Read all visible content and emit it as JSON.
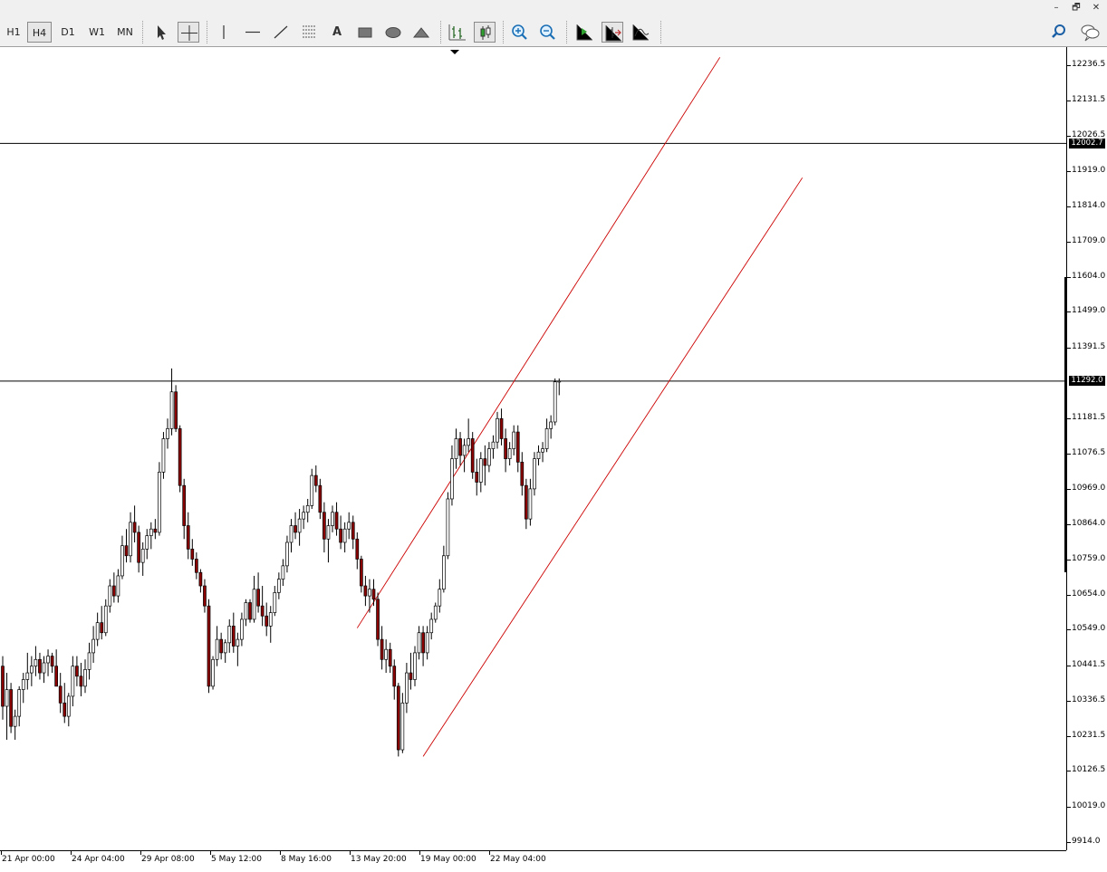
{
  "window": {
    "minimize": "–",
    "restore": "🗗",
    "close": "✕"
  },
  "toolbar": {
    "timeframes": [
      "H1",
      "H4",
      "D1",
      "W1",
      "MN"
    ],
    "active_timeframe": "H4",
    "tools": [
      "cursor-icon",
      "crosshair-icon",
      "vertical-line-icon",
      "horizontal-line-icon",
      "trendline-icon",
      "fibonacci-icon",
      "text-icon",
      "rectangle-icon",
      "ellipse-icon",
      "triangle-icon",
      "bar-chart-icon",
      "candlestick-icon",
      "zoom-in-icon",
      "zoom-out-icon",
      "chart-shift-icon",
      "autoscroll-icon",
      "indicators-icon",
      "search-icon",
      "chat-icon"
    ],
    "text_tool_label": "A"
  },
  "price_scale": {
    "labels": [
      "12236.5",
      "12131.5",
      "12026.5",
      "11919.0",
      "11814.0",
      "11709.0",
      "11604.0",
      "11499.0",
      "11391.5",
      "11181.5",
      "11076.5",
      "10969.0",
      "10864.0",
      "10759.0",
      "10654.0",
      "10549.0",
      "10441.5",
      "10336.5",
      "10231.5",
      "10126.5",
      "10019.0",
      "9914.0"
    ],
    "hline_upper": "12002.7",
    "hline_current": "11292.0"
  },
  "time_scale": {
    "labels": [
      "21 Apr 00:00",
      "24 Apr 04:00",
      "29 Apr 08:00",
      "5 May 12:00",
      "8 May 16:00",
      "13 May 20:00",
      "19 May 00:00",
      "22 May 04:00"
    ]
  },
  "colors": {
    "bull": "#ffffff",
    "bear": "#8b0000",
    "channel": "#cc0000",
    "hline": "#000000"
  },
  "chart_data": {
    "type": "candlestick",
    "symbol_timeframe": "H4",
    "ylim": [
      9914.0,
      12236.5
    ],
    "horizontal_lines": [
      12002.7,
      11292.0
    ],
    "channel": {
      "upper": [
        {
          "bar": 86,
          "price": 10554
        },
        {
          "bar": 174,
          "price": 12260
        }
      ],
      "lower": [
        {
          "bar": 102,
          "price": 10170
        },
        {
          "bar": 194,
          "price": 11900
        }
      ]
    },
    "candles": [
      [
        10440,
        10470,
        10280,
        10320
      ],
      [
        10320,
        10420,
        10220,
        10370
      ],
      [
        10370,
        10390,
        10240,
        10260
      ],
      [
        10260,
        10310,
        10220,
        10290
      ],
      [
        10290,
        10380,
        10260,
        10370
      ],
      [
        10370,
        10420,
        10330,
        10400
      ],
      [
        10400,
        10480,
        10370,
        10420
      ],
      [
        10420,
        10470,
        10380,
        10440
      ],
      [
        10440,
        10500,
        10410,
        10460
      ],
      [
        10460,
        10480,
        10400,
        10420
      ],
      [
        10420,
        10470,
        10390,
        10450
      ],
      [
        10450,
        10490,
        10410,
        10470
      ],
      [
        10470,
        10480,
        10420,
        10440
      ],
      [
        10440,
        10490,
        10400,
        10380
      ],
      [
        10380,
        10420,
        10300,
        10330
      ],
      [
        10330,
        10390,
        10270,
        10290
      ],
      [
        10290,
        10360,
        10260,
        10350
      ],
      [
        10350,
        10470,
        10320,
        10440
      ],
      [
        10440,
        10470,
        10380,
        10410
      ],
      [
        10410,
        10450,
        10350,
        10380
      ],
      [
        10380,
        10460,
        10360,
        10430
      ],
      [
        10430,
        10510,
        10400,
        10480
      ],
      [
        10480,
        10560,
        10450,
        10520
      ],
      [
        10520,
        10600,
        10500,
        10570
      ],
      [
        10570,
        10620,
        10520,
        10540
      ],
      [
        10540,
        10640,
        10530,
        10620
      ],
      [
        10620,
        10700,
        10600,
        10680
      ],
      [
        10680,
        10720,
        10630,
        10650
      ],
      [
        10650,
        10730,
        10630,
        10710
      ],
      [
        10710,
        10830,
        10700,
        10800
      ],
      [
        10800,
        10850,
        10750,
        10770
      ],
      [
        10770,
        10900,
        10750,
        10870
      ],
      [
        10870,
        10920,
        10810,
        10840
      ],
      [
        10840,
        10860,
        10720,
        10750
      ],
      [
        10750,
        10810,
        10710,
        10790
      ],
      [
        10790,
        10850,
        10760,
        10830
      ],
      [
        10830,
        10870,
        10790,
        10850
      ],
      [
        10850,
        10880,
        10820,
        10840
      ],
      [
        10840,
        11050,
        10830,
        11020
      ],
      [
        11020,
        11140,
        11000,
        11120
      ],
      [
        11120,
        11180,
        11090,
        11150
      ],
      [
        11150,
        11330,
        11130,
        11260
      ],
      [
        11260,
        11280,
        11140,
        11150
      ],
      [
        11150,
        11160,
        10960,
        10980
      ],
      [
        10980,
        11000,
        10820,
        10860
      ],
      [
        10860,
        10900,
        10760,
        10790
      ],
      [
        10790,
        10820,
        10740,
        10760
      ],
      [
        10760,
        10780,
        10700,
        10720
      ],
      [
        10720,
        10730,
        10660,
        10680
      ],
      [
        10680,
        10700,
        10600,
        10620
      ],
      [
        10620,
        10640,
        10360,
        10380
      ],
      [
        10380,
        10470,
        10370,
        10460
      ],
      [
        10460,
        10560,
        10440,
        10520
      ],
      [
        10520,
        10540,
        10460,
        10480
      ],
      [
        10480,
        10520,
        10450,
        10510
      ],
      [
        10510,
        10580,
        10480,
        10560
      ],
      [
        10560,
        10600,
        10480,
        10500
      ],
      [
        10500,
        10540,
        10440,
        10520
      ],
      [
        10520,
        10600,
        10500,
        10580
      ],
      [
        10580,
        10640,
        10560,
        10630
      ],
      [
        10630,
        10640,
        10570,
        10580
      ],
      [
        10580,
        10710,
        10570,
        10670
      ],
      [
        10670,
        10720,
        10600,
        10620
      ],
      [
        10620,
        10680,
        10560,
        10590
      ],
      [
        10590,
        10630,
        10530,
        10560
      ],
      [
        10560,
        10620,
        10510,
        10600
      ],
      [
        10600,
        10680,
        10590,
        10660
      ],
      [
        10660,
        10720,
        10640,
        10700
      ],
      [
        10700,
        10760,
        10680,
        10740
      ],
      [
        10740,
        10830,
        10720,
        10810
      ],
      [
        10810,
        10880,
        10780,
        10860
      ],
      [
        10860,
        10900,
        10820,
        10840
      ],
      [
        10840,
        10910,
        10800,
        10880
      ],
      [
        10880,
        10920,
        10850,
        10900
      ],
      [
        10900,
        10940,
        10870,
        10920
      ],
      [
        10920,
        11030,
        10910,
        11010
      ],
      [
        11010,
        11040,
        10960,
        10980
      ],
      [
        10980,
        11000,
        10880,
        10900
      ],
      [
        10900,
        10930,
        10780,
        10820
      ],
      [
        10820,
        10880,
        10750,
        10860
      ],
      [
        10860,
        10920,
        10840,
        10900
      ],
      [
        10900,
        10930,
        10830,
        10850
      ],
      [
        10850,
        10890,
        10790,
        10810
      ],
      [
        10810,
        10870,
        10780,
        10850
      ],
      [
        10850,
        10900,
        10820,
        10870
      ],
      [
        10870,
        10890,
        10790,
        10820
      ],
      [
        10820,
        10840,
        10730,
        10760
      ],
      [
        10760,
        10770,
        10660,
        10680
      ],
      [
        10680,
        10710,
        10620,
        10650
      ],
      [
        10650,
        10700,
        10600,
        10670
      ],
      [
        10670,
        10700,
        10620,
        10640
      ],
      [
        10640,
        10660,
        10500,
        10520
      ],
      [
        10520,
        10560,
        10430,
        10460
      ],
      [
        10460,
        10520,
        10420,
        10490
      ],
      [
        10490,
        10510,
        10420,
        10440
      ],
      [
        10440,
        10460,
        10340,
        10380
      ],
      [
        10380,
        10390,
        10170,
        10190
      ],
      [
        10190,
        10360,
        10180,
        10330
      ],
      [
        10330,
        10450,
        10300,
        10420
      ],
      [
        10420,
        10480,
        10370,
        10400
      ],
      [
        10400,
        10500,
        10380,
        10480
      ],
      [
        10480,
        10560,
        10460,
        10540
      ],
      [
        10540,
        10560,
        10440,
        10480
      ],
      [
        10480,
        10560,
        10460,
        10540
      ],
      [
        10540,
        10600,
        10520,
        10580
      ],
      [
        10580,
        10630,
        10570,
        10620
      ],
      [
        10620,
        10700,
        10600,
        10670
      ],
      [
        10670,
        10800,
        10660,
        10770
      ],
      [
        10770,
        10960,
        10760,
        10940
      ],
      [
        10940,
        11100,
        10920,
        11060
      ],
      [
        11060,
        11150,
        11030,
        11120
      ],
      [
        11120,
        11140,
        11040,
        11070
      ],
      [
        11070,
        11120,
        11020,
        11100
      ],
      [
        11100,
        11180,
        11080,
        11120
      ],
      [
        11120,
        11140,
        11000,
        11020
      ],
      [
        11020,
        11060,
        10950,
        10990
      ],
      [
        10990,
        11080,
        10960,
        11060
      ],
      [
        11060,
        11100,
        10980,
        11040
      ],
      [
        11040,
        11110,
        11020,
        11090
      ],
      [
        11090,
        11130,
        11060,
        11110
      ],
      [
        11110,
        11200,
        11090,
        11180
      ],
      [
        11180,
        11210,
        11100,
        11120
      ],
      [
        11120,
        11150,
        11020,
        11060
      ],
      [
        11060,
        11110,
        11040,
        11090
      ],
      [
        11090,
        11160,
        11070,
        11140
      ],
      [
        11140,
        11160,
        11020,
        11050
      ],
      [
        11050,
        11080,
        10950,
        10980
      ],
      [
        10980,
        11000,
        10850,
        10880
      ],
      [
        10880,
        11000,
        10860,
        10970
      ],
      [
        10970,
        11080,
        10950,
        11060
      ],
      [
        11060,
        11100,
        11040,
        11080
      ],
      [
        11080,
        11110,
        11050,
        11090
      ],
      [
        11090,
        11180,
        11080,
        11150
      ],
      [
        11150,
        11190,
        11120,
        11170
      ],
      [
        11170,
        11300,
        11160,
        11290
      ],
      [
        11290,
        11300,
        11250,
        11292
      ]
    ]
  }
}
